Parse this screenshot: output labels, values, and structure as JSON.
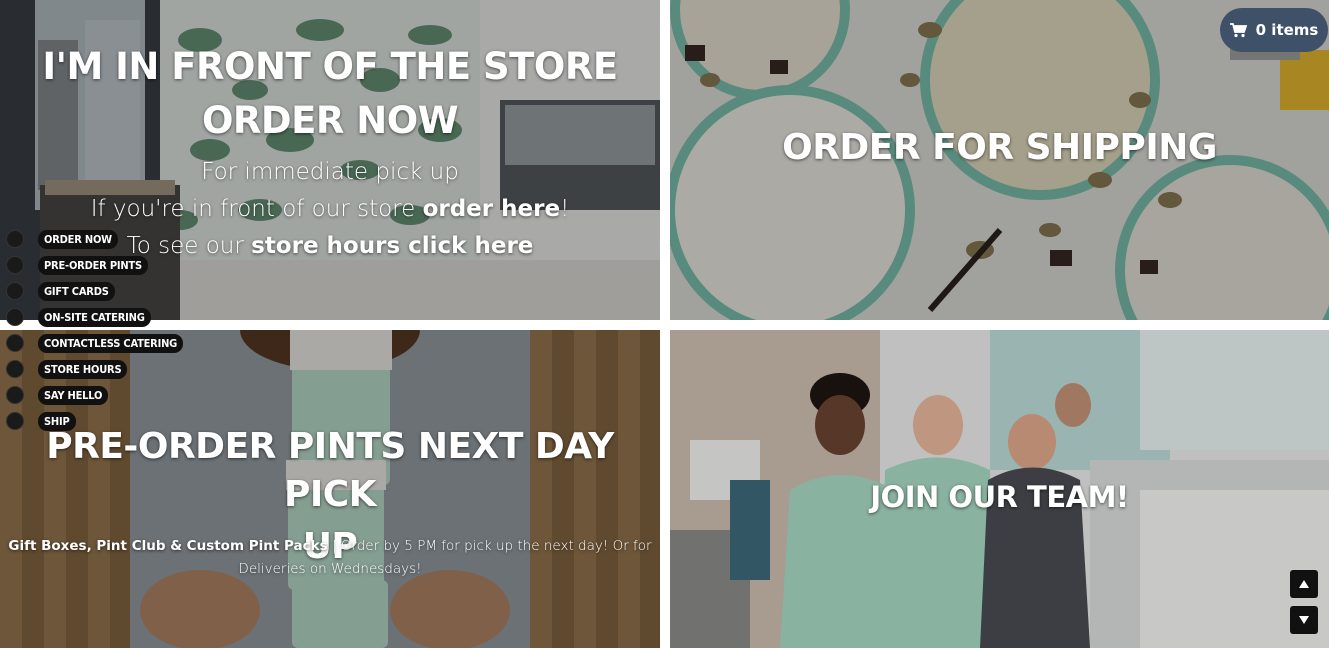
{
  "store_panel": {
    "title_line1": "I'M IN FRONT OF THE STORE",
    "title_line2": "ORDER NOW",
    "line1": "For immediate pick up",
    "line2_prefix": "If you're in front of our store ",
    "line2_link": "order here",
    "line2_suffix": "!",
    "line3_prefix": "To see our ",
    "line3_link": "store hours click here"
  },
  "shipping_panel": {
    "title": "ORDER FOR SHIPPING"
  },
  "preorder_panel": {
    "title_line1": "PRE-ORDER PINTS NEXT DAY PICK",
    "title_line2": "UP",
    "desc_bold": "Gift Boxes, Pint Club & Custom Pint Packs",
    "desc_rest": " | Order by 5 PM for pick up the next day! Or for",
    "desc_line2": "Deliveries on Wednesdays!"
  },
  "team_panel": {
    "title": "JOIN OUR TEAM!"
  },
  "side_nav": {
    "items": [
      {
        "label": "ORDER NOW"
      },
      {
        "label": "PRE-ORDER PINTS"
      },
      {
        "label": "GIFT CARDS"
      },
      {
        "label": "ON-SITE CATERING"
      },
      {
        "label": "CONTACTLESS CATERING"
      },
      {
        "label": "STORE HOURS"
      },
      {
        "label": "SAY HELLO"
      },
      {
        "label": "SHIP"
      }
    ]
  },
  "cart": {
    "icon": "shopping-cart-icon",
    "label": "0 items"
  },
  "scroll_controls": {
    "up_icon": "arrow-up-icon",
    "down_icon": "arrow-down-icon"
  },
  "colors": {
    "cart_bg": "#3f5168",
    "mint": "#a8dcc7",
    "nav_pill_bg": "#111111"
  }
}
